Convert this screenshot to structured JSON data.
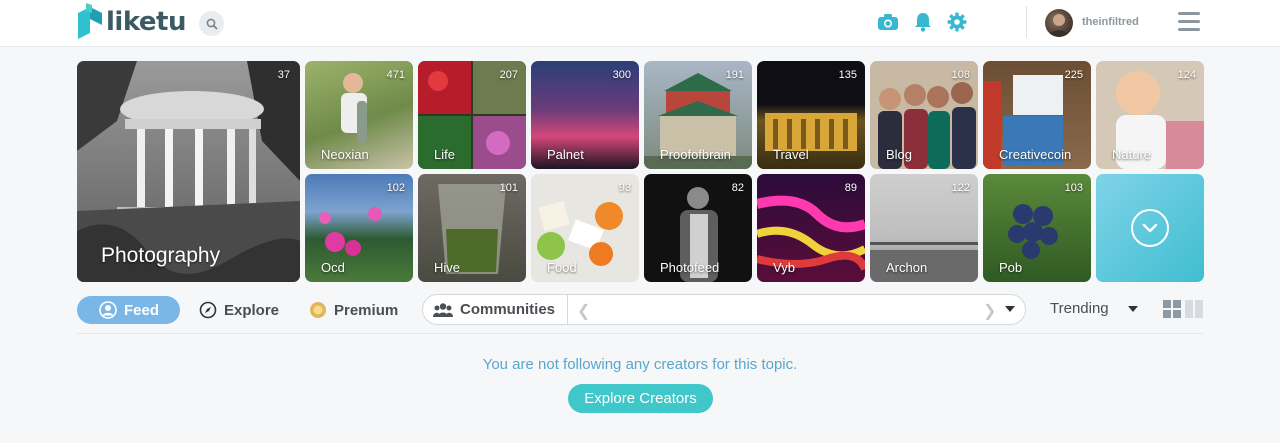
{
  "app": {
    "name": "liketu"
  },
  "header": {
    "search_icon": "search-icon",
    "icons": [
      "camera-icon",
      "bell-icon",
      "gear-icon",
      "menu-icon"
    ],
    "username": "theinfiltred"
  },
  "featured": {
    "label": "Photography",
    "count": "37"
  },
  "tiles": [
    {
      "label": "Neoxian",
      "count": "471"
    },
    {
      "label": "Life",
      "count": "207"
    },
    {
      "label": "Palnet",
      "count": "300"
    },
    {
      "label": "Proofofbrain",
      "count": "191"
    },
    {
      "label": "Travel",
      "count": "135"
    },
    {
      "label": "Blog",
      "count": "108"
    },
    {
      "label": "Creativecoin",
      "count": "225"
    },
    {
      "label": "Nature",
      "count": "124"
    },
    {
      "label": "Ocd",
      "count": "102"
    },
    {
      "label": "Hive",
      "count": "101"
    },
    {
      "label": "Food",
      "count": "93"
    },
    {
      "label": "Photofeed",
      "count": "82"
    },
    {
      "label": "Vyb",
      "count": "89"
    },
    {
      "label": "Archon",
      "count": "122"
    },
    {
      "label": "Pob",
      "count": "103"
    }
  ],
  "tabs": {
    "feed": "Feed",
    "explore": "Explore",
    "premium": "Premium",
    "communities": "Communities"
  },
  "sort": {
    "selected": "Trending"
  },
  "empty_state": {
    "message": "You are not following any creators for this topic.",
    "button": "Explore Creators"
  },
  "colors": {
    "accent": "#3fc7c9",
    "feed_pill": "#7ab7e6",
    "icon_teal": "#38b8cf",
    "message": "#5aa6cf"
  }
}
